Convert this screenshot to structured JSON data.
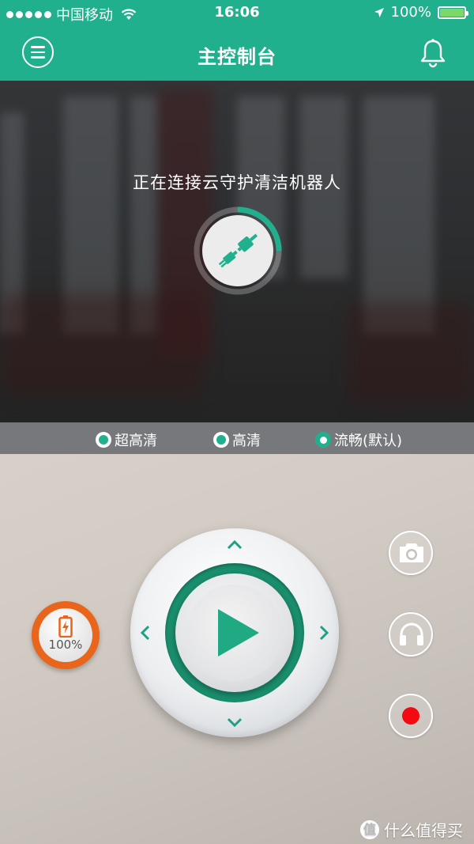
{
  "status_bar": {
    "carrier": "中国移动",
    "time": "16:06",
    "battery_pct": "100%",
    "icons": [
      "signal-dots-icon",
      "wifi-icon",
      "location-arrow-icon",
      "battery-icon"
    ]
  },
  "header": {
    "title": "主控制台",
    "menu_icon": "menu-icon",
    "bell_icon": "bell-icon",
    "accent_color": "#20b08d"
  },
  "video": {
    "connecting_text": "正在连接云守护清洁机器人",
    "plug_icon": "plug-icon",
    "connection_progress": 0.25
  },
  "quality": {
    "options": [
      {
        "label": "超高清",
        "selected": false
      },
      {
        "label": "高清",
        "selected": false
      },
      {
        "label": "流畅(默认)",
        "selected": true
      }
    ]
  },
  "controls": {
    "battery_label": "100%",
    "battery_level": 1.0,
    "battery_color": "#e8651b",
    "play_icon": "play-icon",
    "arrow_icons": [
      "chevron-up-icon",
      "chevron-left-icon",
      "chevron-right-icon",
      "chevron-down-icon"
    ],
    "side_buttons": [
      "camera-icon",
      "headphones-icon",
      "record-icon"
    ],
    "record_color": "#f30b12"
  },
  "watermark": {
    "text": "什么值得买",
    "icon_label": "值"
  }
}
